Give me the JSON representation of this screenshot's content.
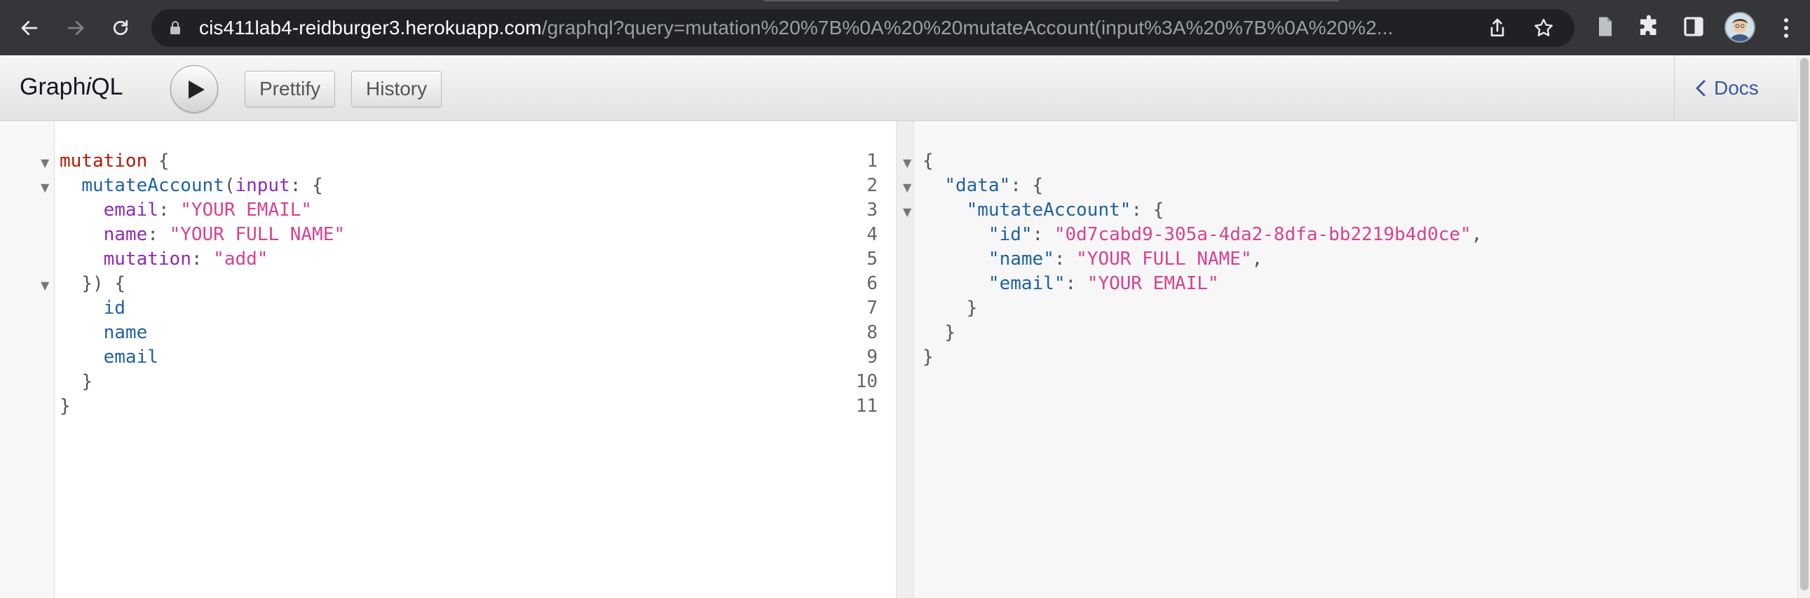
{
  "browser": {
    "url_host": "cis411lab4-reidburger3.herokuapp.com",
    "url_path": "/graphql?query=mutation%20%7B%0A%20%20mutateAccount(input%3A%20%7B%0A%20%2..."
  },
  "toolbar": {
    "title_prefix": "Graph",
    "title_italic": "i",
    "title_suffix": "QL",
    "prettify_label": "Prettify",
    "history_label": "History",
    "docs_label": "Docs"
  },
  "query_editor": {
    "line_numbers": [
      "1",
      "2",
      "3",
      "4",
      "5",
      "6",
      "7",
      "8",
      "9",
      "10",
      "11"
    ],
    "lines": {
      "l1_kw": "mutation",
      "l1_punc": " {",
      "l2_def": "mutateAccount",
      "l2_punc1": "(",
      "l2_arg": "input",
      "l2_punc2": ": {",
      "l3_arg": "email",
      "l3_punc": ": ",
      "l3_str": "\"YOUR EMAIL\"",
      "l4_arg": "name",
      "l4_punc": ": ",
      "l4_str": "\"YOUR FULL NAME\"",
      "l5_arg": "mutation",
      "l5_punc": ": ",
      "l5_str": "\"add\"",
      "l6_punc": "}) {",
      "l7_fld": "id",
      "l8_fld": "name",
      "l9_fld": "email",
      "l10_punc": "}",
      "l11_punc": "}"
    }
  },
  "result_viewer": {
    "lines": {
      "r1": "{",
      "r2_key": "\"data\"",
      "r2_punc": ": {",
      "r3_key": "\"mutateAccount\"",
      "r3_punc": ": {",
      "r4_key": "\"id\"",
      "r4_punc": ": ",
      "r4_str": "\"0d7cabd9-305a-4da2-8dfa-bb2219b4d0ce\"",
      "r4_comma": ",",
      "r5_key": "\"name\"",
      "r5_punc": ": ",
      "r5_str": "\"YOUR FULL NAME\"",
      "r5_comma": ",",
      "r6_key": "\"email\"",
      "r6_punc": ": ",
      "r6_str": "\"YOUR EMAIL\"",
      "r7": "}",
      "r8": "}",
      "r9": "}"
    }
  },
  "colors": {
    "keyword": "#b11a04",
    "definition": "#1f61a0",
    "argument": "#8b2bb9",
    "string": "#d64292",
    "docs_link": "#3b5998"
  }
}
